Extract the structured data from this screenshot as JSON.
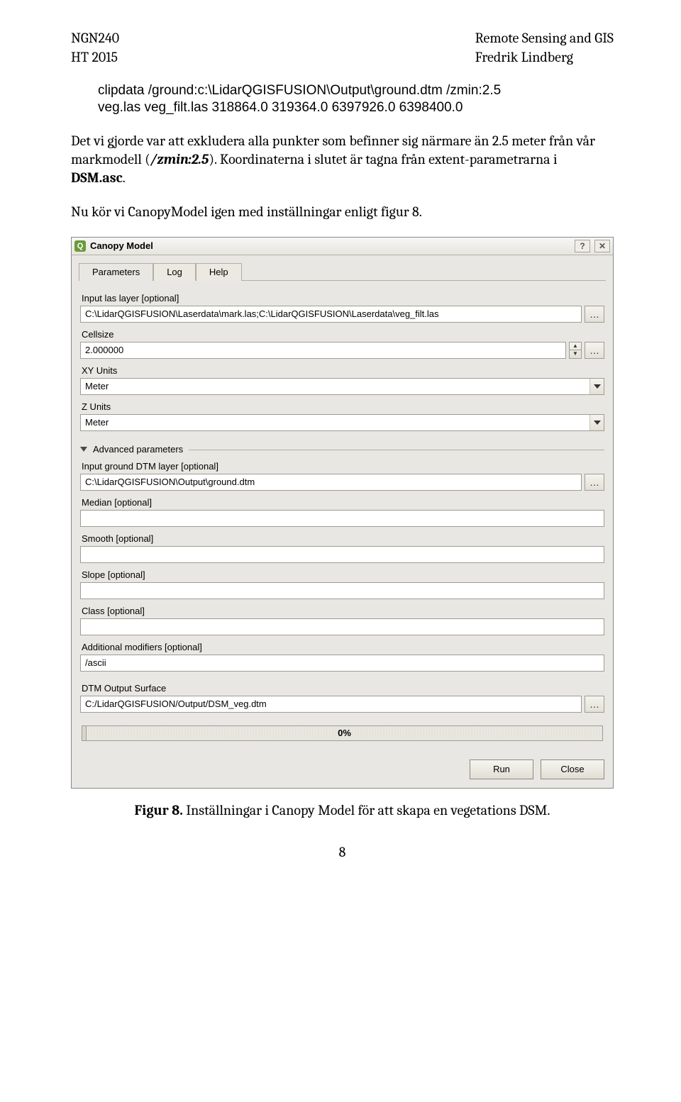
{
  "header": {
    "left_top": "NGN240",
    "left_bot": "HT 2015",
    "right_top": "Remote Sensing and GIS",
    "right_bot": "Fredrik Lindberg"
  },
  "code": {
    "l1": "clipdata /ground:c:\\LidarQGISFUSION\\Output\\ground.dtm /zmin:2.5",
    "l2": "veg.las veg_filt.las 318864.0 319364.0 6397926.0 6398400.0"
  },
  "para1_a": "Det vi gjorde var att exkludera alla punkter som befinner sig närmare än 2.5 meter från vår markmodell (",
  "para1_b": "/zmin:2.5",
  "para1_c": "). Koordinaterna i slutet är tagna från extent-parametrarna i ",
  "para1_d": "DSM.asc",
  "para1_e": ".",
  "para2": "Nu kör vi CanopyModel igen med inställningar enligt figur 8.",
  "dlg": {
    "title": "Canopy Model",
    "tabs": [
      "Parameters",
      "Log",
      "Help"
    ],
    "fields": {
      "input_las_lbl": "Input las layer [optional]",
      "input_las_val": "C:\\LidarQGISFUSION\\Laserdata\\mark.las;C:\\LidarQGISFUSION\\Laserdata\\veg_filt.las",
      "cellsize_lbl": "Cellsize",
      "cellsize_val": "2.000000",
      "xy_lbl": "XY Units",
      "xy_val": "Meter",
      "z_lbl": "Z Units",
      "z_val": "Meter",
      "adv_lbl": "Advanced parameters",
      "dtm_lbl": "Input ground DTM layer [optional]",
      "dtm_val": "C:\\LidarQGISFUSION\\Output\\ground.dtm",
      "median_lbl": "Median [optional]",
      "median_val": "",
      "smooth_lbl": "Smooth [optional]",
      "smooth_val": "",
      "slope_lbl": "Slope [optional]",
      "slope_val": "",
      "class_lbl": "Class [optional]",
      "class_val": "",
      "addmod_lbl": "Additional modifiers [optional]",
      "addmod_val": "/ascii",
      "out_lbl": "DTM Output Surface",
      "out_val": "C:/LidarQGISFUSION/Output/DSM_veg.dtm"
    },
    "progress": "0%",
    "run": "Run",
    "close": "Close"
  },
  "caption_b": "Figur 8.",
  "caption_r": " Inställningar i Canopy Model för att skapa en vegetations DSM.",
  "page_num": "8"
}
